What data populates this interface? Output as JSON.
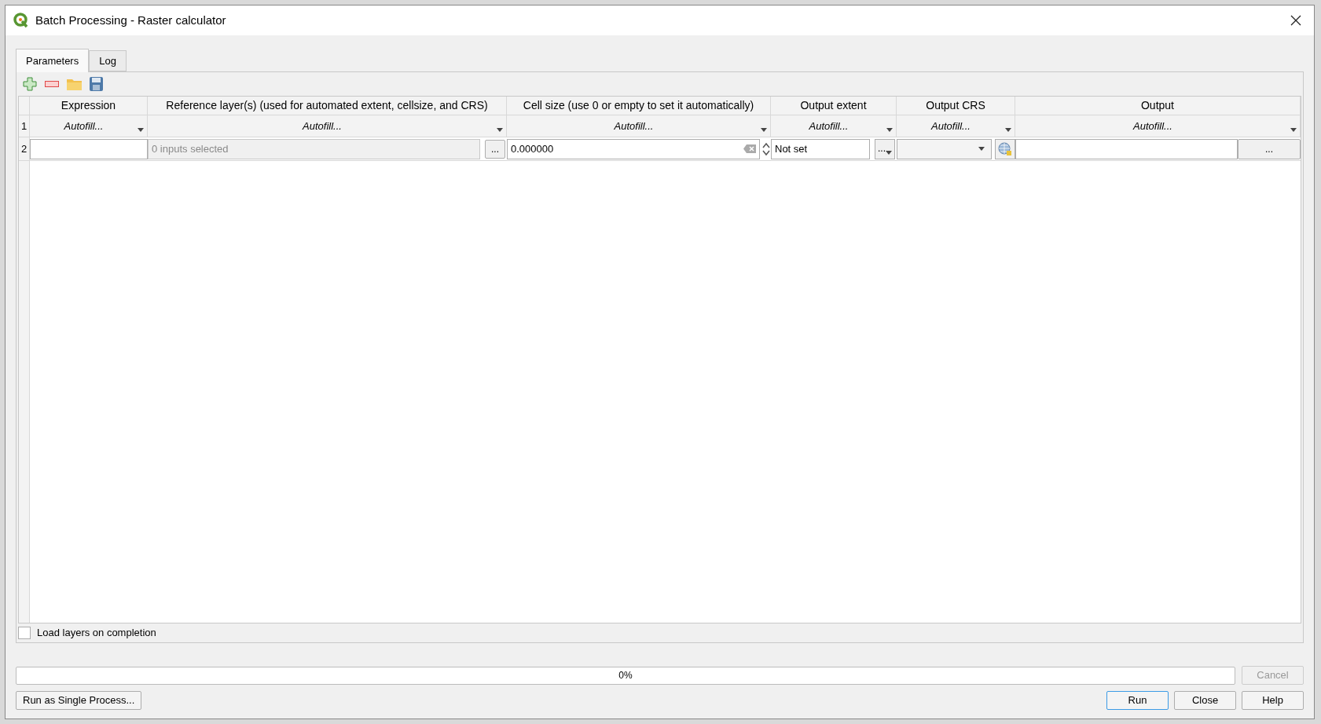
{
  "window": {
    "title": "Batch Processing - Raster calculator"
  },
  "tabs": [
    {
      "label": "Parameters",
      "selected": true
    },
    {
      "label": "Log",
      "selected": false
    }
  ],
  "table": {
    "columns": [
      "Expression",
      "Reference layer(s) (used for automated extent, cellsize, and CRS)",
      "Cell size (use 0 or empty to set it automatically)",
      "Output extent",
      "Output CRS",
      "Output"
    ],
    "autofill_row": {
      "number": "1",
      "cells": [
        "Autofill...",
        "Autofill...",
        "Autofill...",
        "Autofill...",
        "Autofill...",
        "Autofill..."
      ]
    },
    "rows": [
      {
        "number": "2",
        "cells": [
          {
            "kind": "text"
          },
          {
            "kind": "picker",
            "placeholder": "0 inputs selected",
            "button": "..."
          },
          {
            "kind": "spin",
            "value": "0.000000"
          },
          {
            "kind": "extent",
            "value": "Not set",
            "button": "..."
          },
          {
            "kind": "crs"
          },
          {
            "kind": "file",
            "button": "..."
          }
        ]
      }
    ]
  },
  "load_layers": {
    "label": "Load layers on completion",
    "checked": false
  },
  "progress": {
    "text": "0%",
    "level": 0
  },
  "buttons": [
    {
      "label": "Cancel",
      "disabled": true,
      "default": false
    },
    {
      "label": "Run as Single Process...",
      "disabled": false,
      "default": false
    },
    {
      "label": "Run",
      "disabled": false,
      "default": true
    },
    {
      "label": "Close",
      "disabled": false,
      "default": false
    },
    {
      "label": "Help",
      "disabled": false,
      "default": false
    }
  ]
}
